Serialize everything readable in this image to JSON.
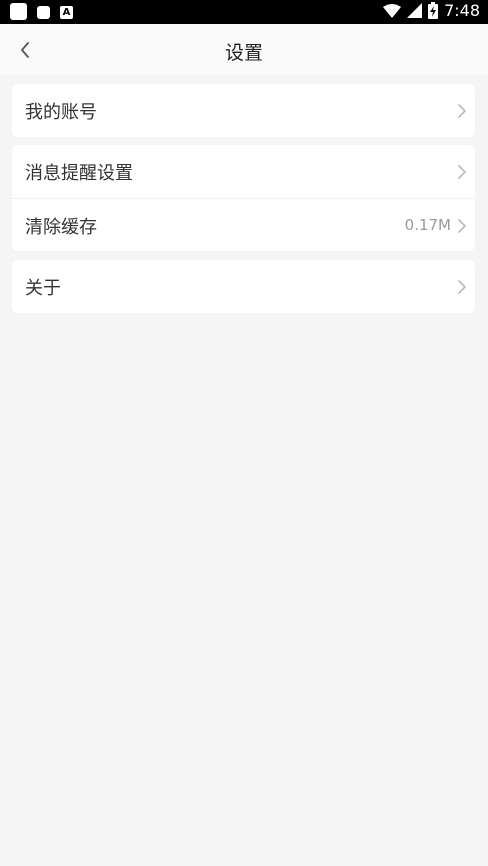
{
  "status_bar": {
    "time": "7:48",
    "icons": [
      "app-square-icon",
      "message-icon",
      "font-a-icon",
      "wifi-icon",
      "signal-icon",
      "battery-charging-icon"
    ]
  },
  "app_bar": {
    "title": "设置",
    "back_icon": "chevron-left-icon"
  },
  "sections": [
    {
      "items": [
        {
          "label": "我的账号"
        }
      ]
    },
    {
      "items": [
        {
          "label": "消息提醒设置"
        },
        {
          "label": "清除缓存",
          "value": "0.17M"
        }
      ]
    },
    {
      "items": [
        {
          "label": "关于"
        }
      ]
    }
  ],
  "colors": {
    "background": "#f5f5f5",
    "card": "#ffffff",
    "text": "#333333",
    "muted": "#9a9a9a",
    "status_bar": "#000000"
  }
}
